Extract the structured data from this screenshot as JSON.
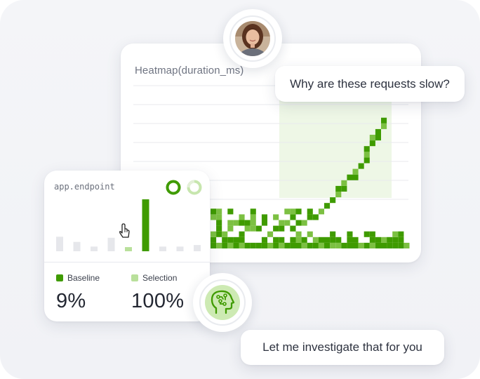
{
  "heatmap": {
    "title": "Heatmap(duration_ms)",
    "colors": {
      "dark": "#3f9b00",
      "light": "#7cc042",
      "selection_bg": "#eef7e6",
      "grid": "#e8eaee"
    }
  },
  "chat": {
    "question": "Why are these requests slow?",
    "answer": "Let me investigate that for you"
  },
  "endpoint_card": {
    "label": "app.endpoint",
    "legend": [
      {
        "name": "Baseline",
        "color": "#3f9b00",
        "percent": "9%"
      },
      {
        "name": "Selection",
        "color": "#b9e09b",
        "percent": "100%"
      }
    ],
    "bars": {
      "baseline_color": "#e6e7eb",
      "selection_color": "#b9e09b",
      "highlight_color": "#3f9b00",
      "values": [
        0.28,
        0.18,
        0.09,
        0.26,
        0.08,
        1.0,
        0.09,
        0.09,
        0.12
      ],
      "highlight_index": 5
    }
  },
  "icons": {
    "cursor": "hand-pointer-icon",
    "ai": "brain-circuit-icon"
  }
}
